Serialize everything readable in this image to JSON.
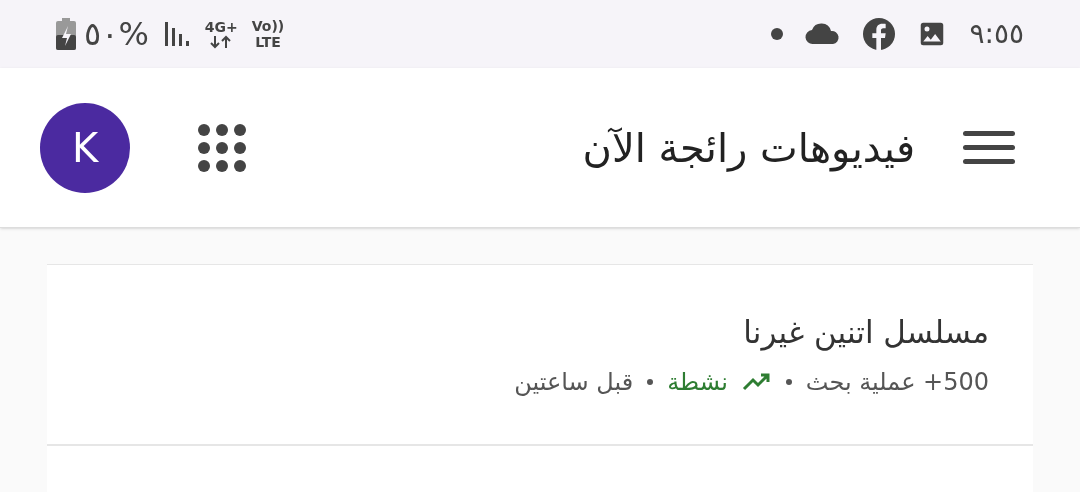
{
  "status_bar": {
    "battery": "%٥٠",
    "network": "4G+",
    "volte": "Vo))",
    "lte": "LTE",
    "time": "٩:٥٥"
  },
  "app_bar": {
    "title": "فيديوهات رائجة الآن",
    "avatar": "K"
  },
  "trends": [
    {
      "title": "مسلسل اتنين غيرنا",
      "searches": "500+ عملية بحث",
      "status": "نشطة",
      "active": true,
      "time": "قبل ساعتين"
    }
  ]
}
